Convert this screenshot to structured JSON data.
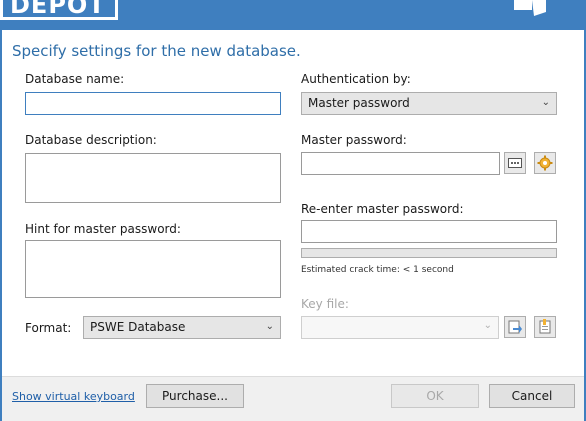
{
  "header": {
    "brand": "DEPOT"
  },
  "form": {
    "subtitle": "Specify settings for the new database.",
    "database_name_label": "Database name:",
    "database_name_value": "",
    "database_description_label": "Database description:",
    "database_description_value": "",
    "hint_label": "Hint for master password:",
    "hint_value": "",
    "format_label": "Format:",
    "format_value": "PSWE Database",
    "auth_label": "Authentication by:",
    "auth_value": "Master password",
    "master_password_label": "Master password:",
    "master_password_value": "",
    "reenter_label": "Re-enter master password:",
    "reenter_value": "",
    "crack_time": "Estimated crack time: < 1 second",
    "password_strength_fraction": 0,
    "key_file_label": "Key file:",
    "key_file_value": ""
  },
  "footer": {
    "keyboard_link": "Show virtual keyboard",
    "purchase": "Purchase...",
    "ok": "OK",
    "cancel": "Cancel"
  },
  "colors": {
    "accent": "#3f7fbf",
    "link": "#1f5fa8",
    "title": "#2f6ea8"
  }
}
